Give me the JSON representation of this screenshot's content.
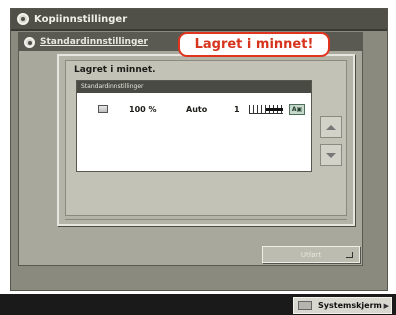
{
  "window": {
    "title": "Kopiinnstillinger",
    "title_icon": "settings-circle-icon"
  },
  "subwindow": {
    "title": "Standardinnstillinger"
  },
  "dialog": {
    "message": "Lagret i minnet.",
    "panel_header": "Standardinnstillinger",
    "row": {
      "paper_icon": "paper-tray-icon",
      "zoom": "100 %",
      "paper": "Auto",
      "copies": "1",
      "density_level": 0.5,
      "image_type_icon": "text-photo-icon"
    },
    "scroll_up_icon": "arrow-up-icon",
    "scroll_down_icon": "arrow-down-icon"
  },
  "callout": {
    "text": "Lagret i minnet!",
    "color": "#d6321c"
  },
  "ok_button": {
    "label": "Utført"
  },
  "bottom_bar": {
    "system_button": "Systemskjerm"
  }
}
